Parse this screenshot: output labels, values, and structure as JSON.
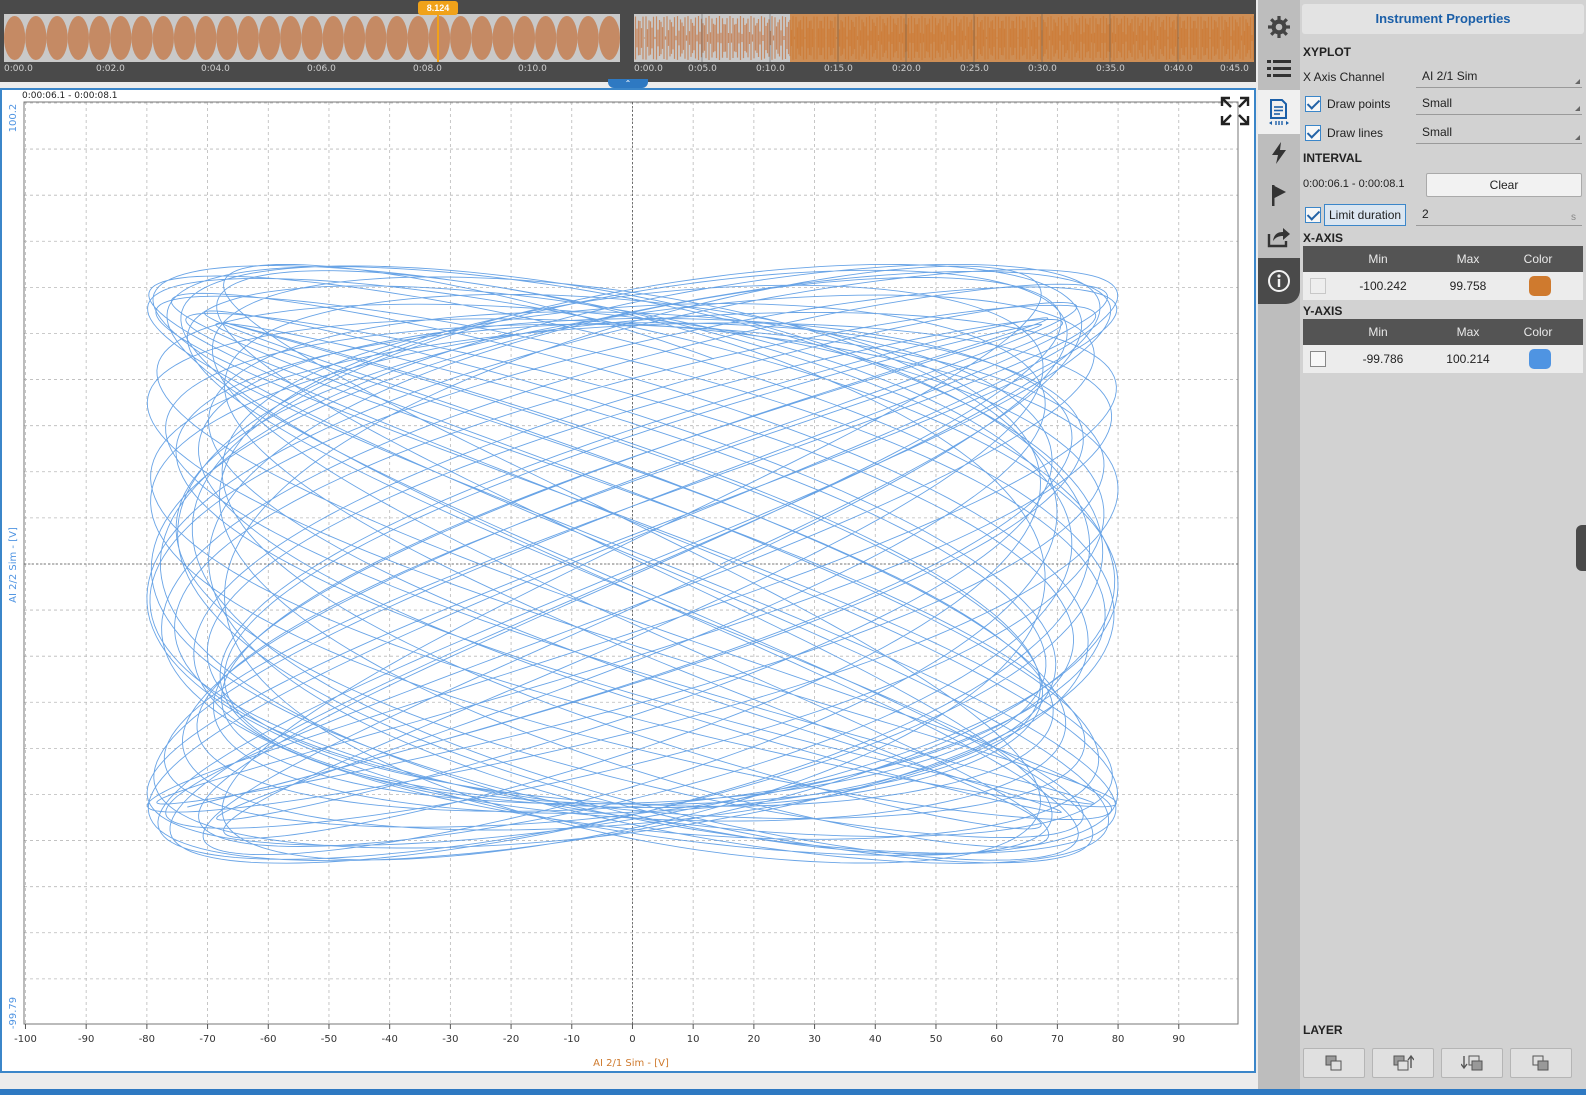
{
  "overview": {
    "cursor_value": "8.124",
    "collapse_glyph": "⌃",
    "left_ticks": [
      "0:00.0",
      "0:02.0",
      "0:04.0",
      "0:06.0",
      "0:08.0",
      "0:10.0"
    ],
    "right_ticks": [
      "0:00.0",
      "0:05.0",
      "0:10.0",
      "0:15.0",
      "0:20.0",
      "0:25.0",
      "0:30.0",
      "0:35.0",
      "0:40.0",
      "0:45.0"
    ],
    "waveform_color": "#c58a64",
    "highlight_color": "#cf7a2e"
  },
  "plot": {
    "interval_label": "0:00:06.1 - 0:00:08.1",
    "y_axis_top": "100.2",
    "y_axis_bottom": "-99.79",
    "y_axis_title": "AI 2/2 Sim - [V]",
    "x_axis_title": "AI 2/1 Sim - [V]",
    "x_ticks": [
      "-100",
      "-90",
      "-80",
      "-70",
      "-60",
      "-50",
      "-40",
      "-30",
      "-20",
      "-10",
      "0",
      "10",
      "20",
      "30",
      "40",
      "50",
      "60",
      "70",
      "80",
      "90"
    ],
    "line_color": "#4f94e2"
  },
  "chart_data": {
    "type": "scatter",
    "title": "",
    "xlabel": "AI 2/1 Sim - [V]",
    "ylabel": "AI 2/2 Sim - [V]",
    "xlim": [
      -100.242,
      99.758
    ],
    "ylim": [
      -99.786,
      100.214
    ],
    "x_ticks": [
      -100,
      -90,
      -80,
      -70,
      -60,
      -50,
      -40,
      -30,
      -20,
      -10,
      0,
      10,
      20,
      30,
      40,
      50,
      60,
      70,
      80,
      90
    ],
    "grid": true,
    "series": [
      {
        "x_amplitude": 80,
        "y_amplitude": 65,
        "x_freq": 3,
        "y_freq": 2
      }
    ]
  },
  "tabs": [
    "settings-gear",
    "list",
    "properties-page",
    "lightning",
    "flag",
    "export-share",
    "info"
  ],
  "props": {
    "title": "Instrument Properties",
    "xyplot_section": "XYPLOT",
    "x_axis_channel_label": "X Axis Channel",
    "x_axis_channel_value": "AI 2/1 Sim",
    "draw_points_label": "Draw points",
    "draw_points_value": "Small",
    "draw_lines_label": "Draw lines",
    "draw_lines_value": "Small",
    "interval_section": "INTERVAL",
    "interval_value": "0:00:06.1 - 0:00:08.1",
    "clear_label": "Clear",
    "limit_duration_label": "Limit duration",
    "limit_duration_value": "2",
    "limit_duration_unit": "s",
    "xaxis_section": "X-AXIS",
    "yaxis_section": "Y-AXIS",
    "col_min": "Min",
    "col_max": "Max",
    "col_color": "Color",
    "xaxis": {
      "min": "-100.242",
      "max": "99.758",
      "color": "#cf7a2e"
    },
    "yaxis": {
      "min": "-99.786",
      "max": "100.214",
      "color": "#4f94e2"
    },
    "layer_section": "LAYER"
  }
}
